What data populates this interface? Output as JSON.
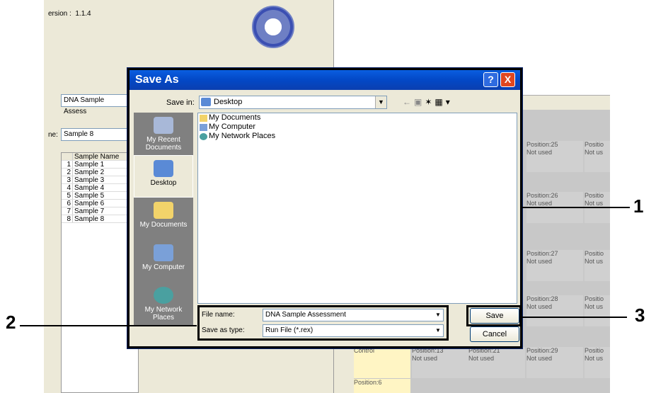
{
  "app": {
    "version_label": "ersion :",
    "version_value": "1.1.4",
    "run_name_value": "DNA Sample Assess",
    "sample_label": "ne:",
    "sample_value": "Sample 8",
    "list_header": "Sample Name",
    "samples": [
      {
        "n": "1",
        "name": "Sample 1"
      },
      {
        "n": "2",
        "name": "Sample 2"
      },
      {
        "n": "3",
        "name": "Sample 3"
      },
      {
        "n": "4",
        "name": "Sample 4"
      },
      {
        "n": "5",
        "name": "Sample 5"
      },
      {
        "n": "6",
        "name": "Sample 6"
      },
      {
        "n": "7",
        "name": "Sample 7"
      },
      {
        "n": "8",
        "name": "Sample 8"
      }
    ],
    "grid": {
      "col1": [
        {
          "p": "Position:25",
          "s": "Not used"
        },
        {
          "p": "Position:26",
          "s": "Not used"
        },
        {
          "p": "Position:27",
          "s": "Not used"
        },
        {
          "p": "Position:28",
          "s": "Not used"
        },
        {
          "p": "Position:29",
          "s": "Not used"
        }
      ],
      "col2": [
        {
          "p": "Positio",
          "s": "Not us"
        },
        {
          "p": "Positio",
          "s": "Not us"
        },
        {
          "p": "Positio",
          "s": "Not us"
        },
        {
          "p": "Positio",
          "s": "Not us"
        },
        {
          "p": "Positio",
          "s": "Not us"
        }
      ],
      "control": "Control",
      "pos13": "Position:13",
      "pos13s": "Not used",
      "pos21": "Position:21",
      "pos21s": "Not used",
      "pos6": "Position:6"
    }
  },
  "dialog": {
    "title": "Save As",
    "help": "?",
    "close": "X",
    "save_in_label": "Save in:",
    "save_in_value": "Desktop",
    "places": [
      {
        "label": "My Recent Documents",
        "icon": "recent-documents-icon"
      },
      {
        "label": "Desktop",
        "icon": "desktop-icon"
      },
      {
        "label": "My Documents",
        "icon": "my-documents-icon"
      },
      {
        "label": "My Computer",
        "icon": "my-computer-icon"
      },
      {
        "label": "My Network Places",
        "icon": "network-places-icon"
      }
    ],
    "files": [
      "My Documents",
      "My Computer",
      "My Network Places"
    ],
    "file_name_label": "File name:",
    "file_name_value": "DNA Sample Assessment",
    "save_type_label": "Save as type:",
    "save_type_value": "Run File (*.rex)",
    "save_button": "Save",
    "cancel_button": "Cancel"
  },
  "callouts": {
    "one": "1",
    "two": "2",
    "three": "3"
  },
  "colors": {
    "titlebar": "#0348c6",
    "close": "#e0471f",
    "highlight": "#000000"
  }
}
